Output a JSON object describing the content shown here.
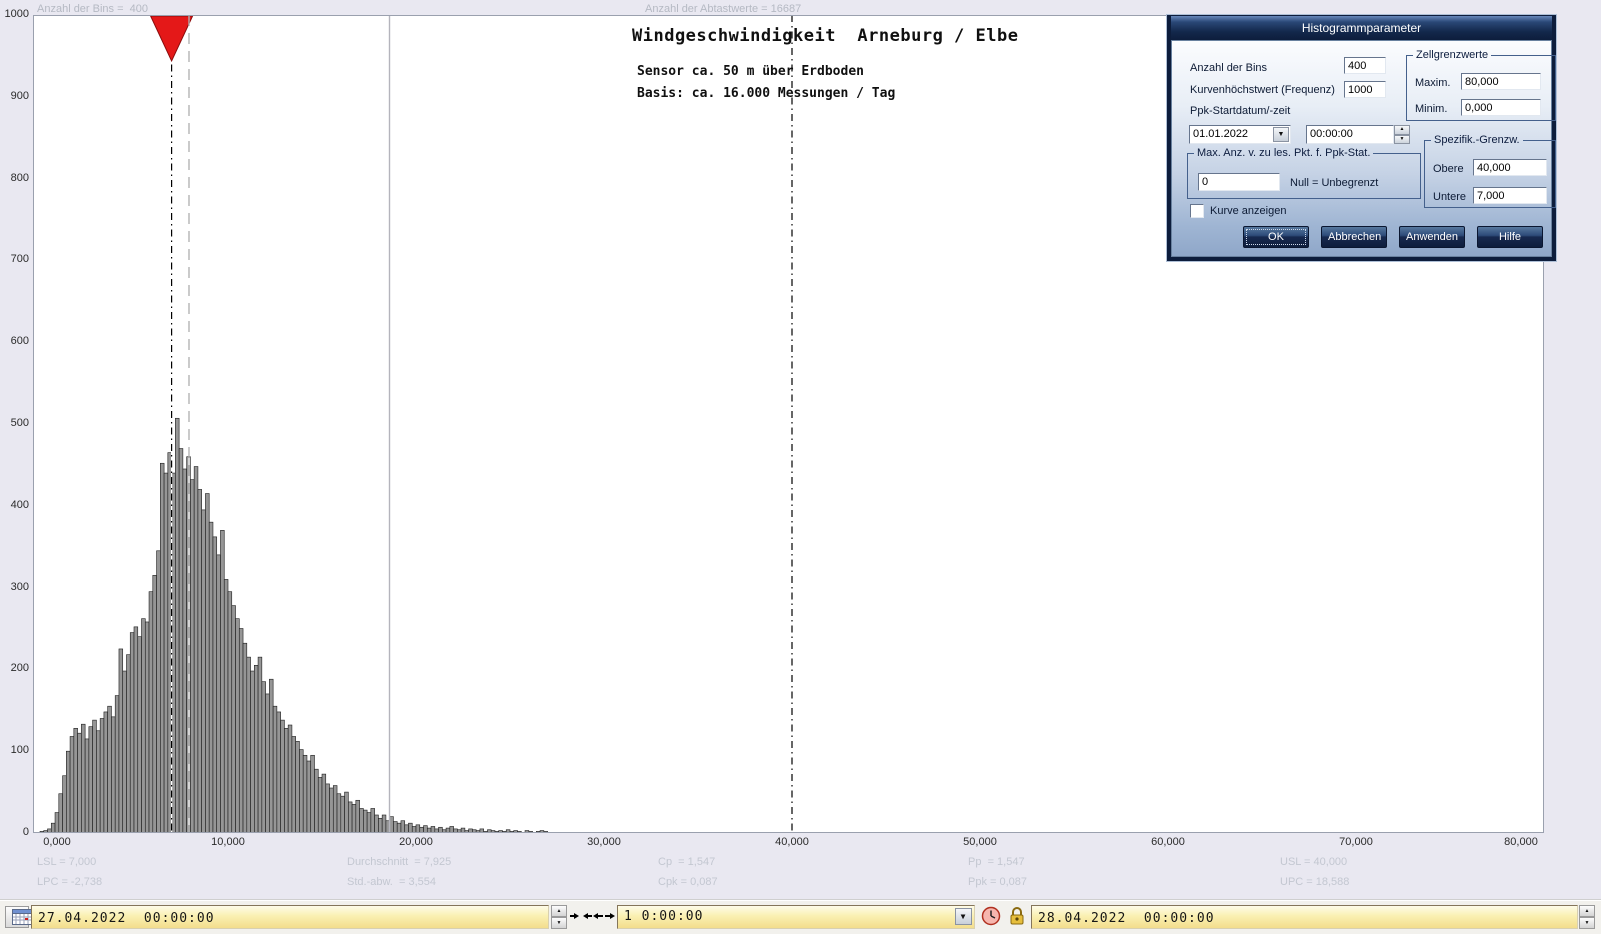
{
  "chart_data": {
    "type": "bar",
    "title": "Windgeschwindigkeit  Arneburg / Elbe",
    "subtitle1": "Sensor ca. 50 m über Erdboden",
    "subtitle2": "Basis: ca. 16.000 Messungen / Tag",
    "info_left": "Anzahl der Bins =  400",
    "info_center": "Anzahl der Abtastwerte = 16687",
    "xlim": [
      0,
      80000
    ],
    "ylim": [
      0,
      1000
    ],
    "x_tick_values": [
      0,
      10000,
      20000,
      30000,
      40000,
      50000,
      60000,
      70000,
      80000
    ],
    "x_tick_labels": [
      "0,000",
      "10,000",
      "20,000",
      "30,000",
      "40,000",
      "50,000",
      "60,000",
      "70,000",
      "80,000"
    ],
    "y_tick_values": [
      0,
      100,
      200,
      300,
      400,
      500,
      600,
      700,
      800,
      900,
      1000
    ],
    "bin_start": 0,
    "bin_width": 200,
    "bin_counts": [
      2,
      3,
      5,
      12,
      25,
      48,
      70,
      100,
      118,
      128,
      122,
      133,
      115,
      130,
      138,
      125,
      140,
      148,
      155,
      142,
      168,
      225,
      198,
      218,
      245,
      252,
      240,
      262,
      258,
      295,
      315,
      345,
      452,
      440,
      465,
      440,
      507,
      470,
      445,
      460,
      432,
      448,
      420,
      395,
      415,
      380,
      362,
      340,
      370,
      310,
      295,
      278,
      262,
      250,
      232,
      215,
      198,
      205,
      215,
      185,
      170,
      188,
      155,
      148,
      138,
      128,
      132,
      118,
      112,
      102,
      95,
      88,
      95,
      78,
      68,
      72,
      60,
      55,
      58,
      48,
      45,
      50,
      38,
      35,
      40,
      30,
      28,
      25,
      30,
      22,
      18,
      22,
      15,
      20,
      14,
      12,
      15,
      10,
      12,
      8,
      10,
      7,
      9,
      6,
      8,
      5,
      7,
      4,
      6,
      8,
      5,
      4,
      6,
      3,
      5,
      4,
      3,
      5,
      2,
      4,
      3,
      2,
      3,
      2,
      4,
      2,
      3,
      2,
      0,
      3,
      2,
      0,
      2,
      3,
      2
    ],
    "reference_lines": [
      {
        "name": "LSL",
        "value": 7000,
        "style": "dash-dot",
        "marker": "red-triangle"
      },
      {
        "name": "Durchschnitt",
        "value": 7925,
        "style": "dashed-gray"
      },
      {
        "name": "UPC",
        "value": 18588,
        "style": "solid-gray"
      },
      {
        "name": "USL",
        "value": 40000,
        "style": "dash-dot"
      }
    ],
    "stats_row1": [
      "LSL = 7,000",
      "Durchschnitt  = 7,925",
      "Cp  = 1,547",
      "Pp  = 1,547",
      "USL = 40,000"
    ],
    "stats_row2": [
      "LPC = -2,738",
      "Std.-abw.  = 3,554",
      "Cpk = 0,087",
      "Ppk = 0,087",
      "UPC = 18,588"
    ],
    "grid": "off",
    "legend": "none"
  },
  "dialog": {
    "title": "Histogrammparameter",
    "bins_label": "Anzahl der Bins",
    "bins_value": "400",
    "freq_label": "Kurvenhöchstwert (Frequenz)",
    "freq_value": "1000",
    "ppk_label": "Ppk-Startdatum/-zeit",
    "date_value": "01.01.2022",
    "time_value": "00:00:00",
    "max_group_label": "Max. Anz. v. zu les. Pkt. f. Ppk-Stat.",
    "max_value": "0",
    "max_hint": "Null = Unbegrenzt",
    "cell_group_label": "Zellgrenzwerte",
    "maxim_label": "Maxim.",
    "maxim_value": "80,000",
    "minim_label": "Minim.",
    "minim_value": "0,000",
    "spec_group_label": "Spezifik.-Grenzw.",
    "obere_label": "Obere",
    "obere_value": "40,000",
    "untere_label": "Untere",
    "untere_value": "7,000",
    "checkbox_label": "Kurve anzeigen",
    "checkbox_checked": false,
    "buttons": {
      "ok": "OK",
      "cancel": "Abbrechen",
      "apply": "Anwenden",
      "help": "Hilfe"
    }
  },
  "statusbar": {
    "start_datetime": "27.04.2022  00:00:00",
    "range_value": "1 0:00:00",
    "end_datetime": "28.04.2022  00:00:00"
  },
  "icons": {
    "calendar": "calendar-grid",
    "clock": "clock-face",
    "lock": "padlock",
    "collapse": "arrows-inward",
    "expand": "arrows-outward",
    "dropdown": "triangle-down"
  },
  "colors": {
    "bar_fill": "#969696",
    "bar_stroke": "#1c1c1c",
    "marker_red": "#e41818",
    "dialog_titlebar": "#13284c",
    "dialog_body_blue": "#8fa7c9",
    "status_field_yellow": "#f8eaa8",
    "chart_bg": "#e9e8f1",
    "stats_text": "#c3c7d1"
  }
}
